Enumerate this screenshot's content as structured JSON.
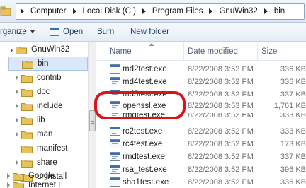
{
  "address": {
    "crumbs": [
      "Computer",
      "Local Disk (C:)",
      "Program Files",
      "GnuWin32",
      "bin"
    ]
  },
  "toolbar": {
    "organize_label": "rganize",
    "open_label": "Open",
    "burn_label": "Burn",
    "new_folder_label": "New folder"
  },
  "nav": {
    "items": [
      {
        "label": "GnuWin32",
        "level": 1,
        "expanded": true,
        "selected": false
      },
      {
        "label": "bin",
        "level": 2,
        "expanded": false,
        "selected": true
      },
      {
        "label": "contrib",
        "level": 2,
        "expanded": false,
        "selected": false
      },
      {
        "label": "doc",
        "level": 2,
        "expanded": false,
        "selected": false
      },
      {
        "label": "include",
        "level": 2,
        "expanded": false,
        "selected": false
      },
      {
        "label": "lib",
        "level": 2,
        "expanded": false,
        "selected": false
      },
      {
        "label": "man",
        "level": 2,
        "expanded": false,
        "selected": false
      },
      {
        "label": "manifest",
        "level": 2,
        "expanded": false,
        "selected": false
      },
      {
        "label": "share",
        "level": 2,
        "expanded": false,
        "selected": false
      },
      {
        "label": "uninstall",
        "level": 2,
        "expanded": false,
        "selected": false
      },
      {
        "label": "Google",
        "level": 1,
        "expanded": false,
        "selected": false
      },
      {
        "label": "Internet E",
        "level": 1,
        "expanded": false,
        "selected": false
      }
    ]
  },
  "columns": {
    "name": "Name",
    "date": "Date modified",
    "size": "Size"
  },
  "files": [
    {
      "name": "md2test.exe",
      "date": "8/22/2008 3:52 PM",
      "size": "336 KB"
    },
    {
      "name": "md4test.exe",
      "date": "8/22/2008 3:52 PM",
      "size": "336 KB"
    },
    {
      "name": "md5test.exe",
      "date": "8/22/2008 3:52 PM",
      "size": "337 KB"
    },
    {
      "name": "openssl.exe",
      "date": "8/22/2008 3:53 PM",
      "size": "1,761 KB"
    },
    {
      "name": "rmdtest.exe",
      "date": "8/22/2008 3:52 PM",
      "size": "333 KB"
    },
    {
      "name": "rc2test.exe",
      "date": "8/22/2008 3:52 PM",
      "size": "333 KB"
    },
    {
      "name": "rc4test.exe",
      "date": "8/22/2008 3:52 PM",
      "size": "173 KB"
    },
    {
      "name": "rmdtest.exe",
      "date": "8/22/2008 3:52 PM",
      "size": "337 KB"
    },
    {
      "name": "rsa_test.exe",
      "date": "8/22/2008 3:52 PM",
      "size": "396 KB"
    },
    {
      "name": "sha1test.exe",
      "date": "8/22/2008 3:52 PM",
      "size": "336 KB"
    }
  ],
  "colors": {
    "highlight_ring": "#d9141b",
    "selection": "#d9e8fb",
    "folder": "#e8c25a"
  }
}
